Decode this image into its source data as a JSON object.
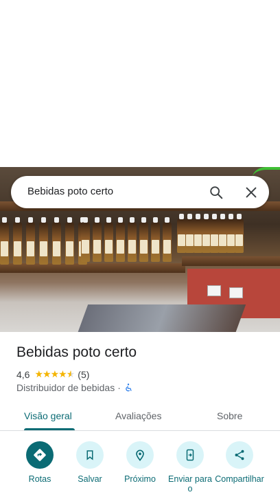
{
  "search": {
    "query": "Bebidas poto certo"
  },
  "place": {
    "name": "Bebidas poto certo",
    "rating": "4,6",
    "stars": 4.6,
    "review_count": "(5)",
    "category": "Distribuidor de bebidas",
    "separator": "·"
  },
  "tabs": [
    {
      "label": "Visão geral",
      "active": true
    },
    {
      "label": "Avaliações",
      "active": false
    },
    {
      "label": "Sobre",
      "active": false
    }
  ],
  "actions": [
    {
      "label": "Rotas",
      "icon": "directions-icon"
    },
    {
      "label": "Salvar",
      "icon": "bookmark-icon"
    },
    {
      "label": "Próximo",
      "icon": "nearby-icon"
    },
    {
      "label": "Enviar para o",
      "icon": "send-to-phone-icon"
    },
    {
      "label": "Compartilhar",
      "icon": "share-icon"
    }
  ],
  "colors": {
    "accent": "#0b6b74",
    "accent_light": "#d9f4f8",
    "star": "#f4b400"
  }
}
